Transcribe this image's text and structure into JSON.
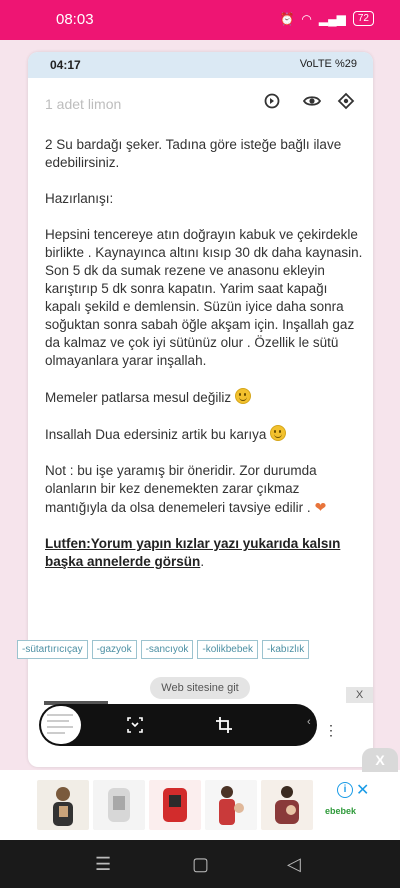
{
  "outer_status": {
    "time": "08:03",
    "battery": "72"
  },
  "inner_status": {
    "time": "04:17",
    "network": "VoLTE",
    "battery": "%29"
  },
  "app": {
    "title": "1 adet limon"
  },
  "content": {
    "p1": "2 Su bardağı şeker.  Tadına göre isteğe bağlı ilave edebilirsiniz.",
    "p2": "Hazırlanışı:",
    "p3": "Hepsini tencereye atın doğrayın kabuk ve çekirdekle birlikte . Kaynayınca altını kısıp 30 dk daha kaynasin. Son 5 dk da sumak rezene ve anasonu ekleyin karıştırıp 5 dk sonra kapatın. Yarim saat kapağı kapalı şekild e demlensin.  Süzün iyice daha sonra soğuktan sonra sabah öğle akşam için.  Inşallah gaz da kalmaz ve çok iyi sütünüz olur . Özellik le sütü olmayanlara yarar inşallah.",
    "p4": "Memeler patlarsa mesul değiliz",
    "p5": "Insallah Dua edersiniz artik bu karıya",
    "p6": "Not : bu işe yaramış bir öneridir.  Zor durumda olanların bir kez denemekten zarar çıkmaz mantığıyla da olsa denemeleri tavsiye edilir .",
    "p7": "Lutfen:Yorum yapın kızlar yazı yukarıda kalsın başka annelerde görsün",
    "p7_end": "."
  },
  "tags": [
    "-sütartırıcıçay",
    "-gazyok",
    "-sancıyok",
    "-kolikbebek",
    "-kabızlık"
  ],
  "toast": "Web sitesine git",
  "ad": {
    "close_small": "X",
    "close_outer": "X",
    "brand": "ebebek",
    "info": "i",
    "close": "✕"
  },
  "icons": {
    "accent": "#ee1573"
  }
}
